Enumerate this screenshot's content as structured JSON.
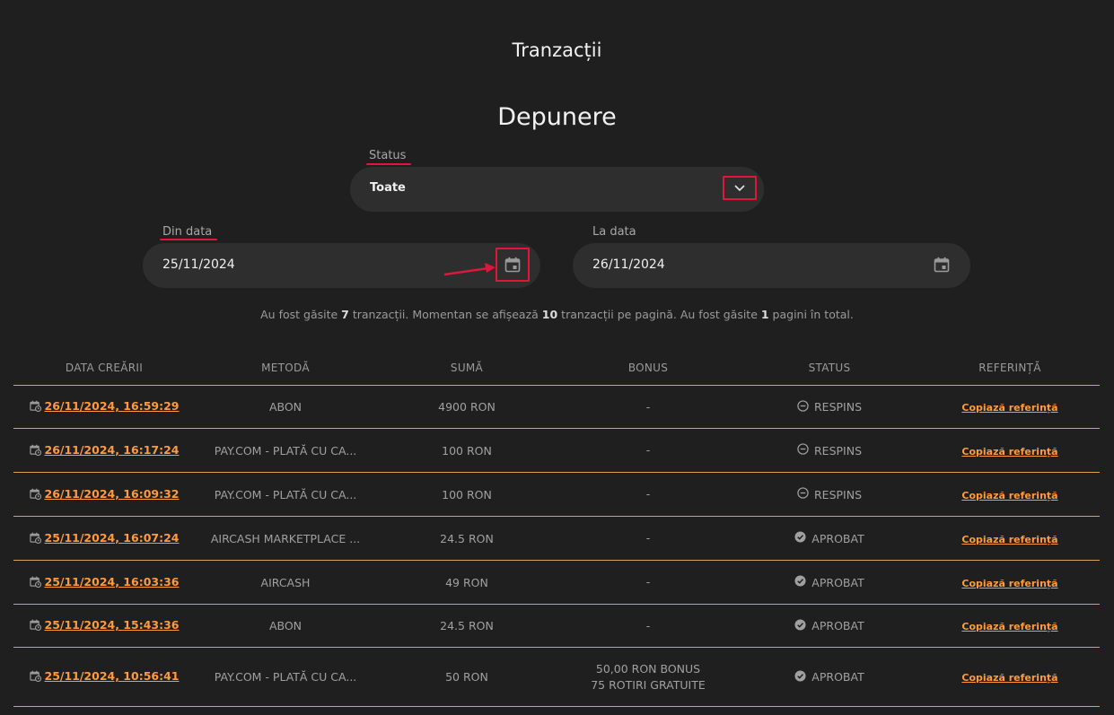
{
  "page_title": "Tranzacții",
  "section_title": "Depunere",
  "filters": {
    "status_label": "Status",
    "status_value": "Toate",
    "from_label": "Din data",
    "from_value": "25/11/2024",
    "to_label": "La data",
    "to_value": "26/11/2024"
  },
  "info": {
    "part1": "Au fost găsite ",
    "found": "7",
    "part2": " tranzacții. Momentan se afișează ",
    "per_page": "10",
    "part3": " tranzacții pe pagină. Au fost găsite ",
    "pages": "1",
    "part4": " pagini în total."
  },
  "table": {
    "headers": [
      "DATA CREĂRII",
      "METODĂ",
      "SUMĂ",
      "BONUS",
      "STATUS",
      "REFERINȚĂ"
    ],
    "rows": [
      {
        "date": "26/11/2024, 16:59:29",
        "method": "ABON",
        "amount": "4900 RON",
        "bonus": "-",
        "bonus2": "",
        "status": "RESPINS",
        "ref": "Copiază referință"
      },
      {
        "date": "26/11/2024, 16:17:24",
        "method": "PAY.COM - PLATĂ CU CA...",
        "amount": "100 RON",
        "bonus": "-",
        "bonus2": "",
        "status": "RESPINS",
        "ref": "Copiază referință"
      },
      {
        "date": "26/11/2024, 16:09:32",
        "method": "PAY.COM - PLATĂ CU CA...",
        "amount": "100 RON",
        "bonus": "-",
        "bonus2": "",
        "status": "RESPINS",
        "ref": "Copiază referință"
      },
      {
        "date": "25/11/2024, 16:07:24",
        "method": "AIRCASH MARKETPLACE ...",
        "amount": "24.5 RON",
        "bonus": "-",
        "bonus2": "",
        "status": "APROBAT",
        "ref": "Copiază referință"
      },
      {
        "date": "25/11/2024, 16:03:36",
        "method": "AIRCASH",
        "amount": "49 RON",
        "bonus": "-",
        "bonus2": "",
        "status": "APROBAT",
        "ref": "Copiază referință"
      },
      {
        "date": "25/11/2024, 15:43:36",
        "method": "ABON",
        "amount": "24.5 RON",
        "bonus": "-",
        "bonus2": "",
        "status": "APROBAT",
        "ref": "Copiază referință"
      },
      {
        "date": "25/11/2024, 10:56:41",
        "method": "PAY.COM - PLATĂ CU CA...",
        "amount": "50 RON",
        "bonus": "50,00 RON BONUS",
        "bonus2": "75 ROTIRI GRATUITE",
        "status": "APROBAT",
        "ref": "Copiază referință"
      }
    ]
  },
  "colors": {
    "background": "#1f1f1f",
    "accent": "#ff9a3c",
    "annotation": "#e0173a",
    "divider": "#d9a05b"
  },
  "icons": {
    "dropdown": "chevron-down-icon",
    "calendar": "calendar-icon",
    "date": "calendar-clock-icon",
    "rejected": "minus-circle-icon",
    "approved": "check-circle-icon"
  }
}
